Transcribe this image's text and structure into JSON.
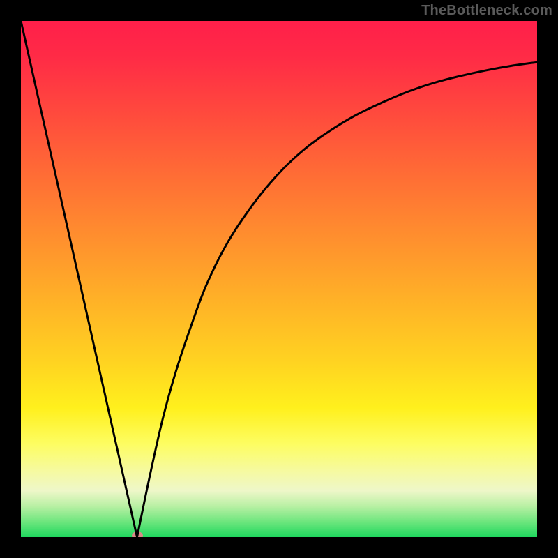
{
  "watermark": "TheBottleneck.com",
  "chart_data": {
    "type": "line",
    "title": "",
    "xlabel": "",
    "ylabel": "",
    "xlim": [
      0,
      100
    ],
    "ylim": [
      0,
      100
    ],
    "grid": false,
    "legend": false,
    "left_branch": {
      "name": "left-branch",
      "x": [
        0,
        5,
        10,
        15,
        20,
        22.5
      ],
      "y": [
        100,
        77.8,
        55.6,
        33.3,
        11.1,
        0
      ]
    },
    "right_branch": {
      "name": "right-branch",
      "x": [
        22.5,
        25,
        27.5,
        30,
        33,
        36,
        40,
        45,
        50,
        55,
        60,
        65,
        70,
        75,
        80,
        85,
        90,
        95,
        100
      ],
      "y": [
        0,
        12,
        23,
        32,
        41,
        49,
        57,
        64.5,
        70.5,
        75.2,
        78.8,
        81.8,
        84.2,
        86.3,
        88,
        89.3,
        90.4,
        91.3,
        92
      ]
    },
    "marker": {
      "x": 22.5,
      "y": 0,
      "color": "#d98a88"
    },
    "colors": {
      "line": "#000000",
      "gradient_top": "#ff1f4a",
      "gradient_bottom": "#1fd85e"
    }
  }
}
